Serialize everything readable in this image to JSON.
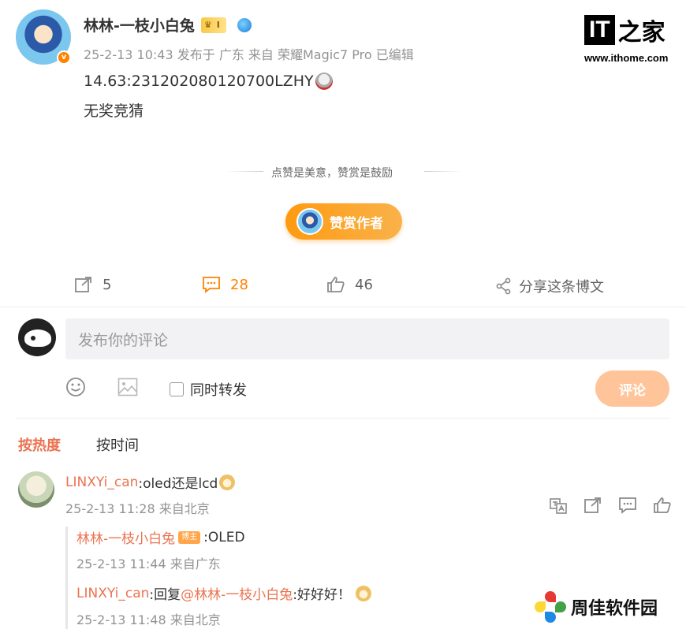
{
  "post": {
    "author": "林林-一枝小白兔",
    "member_badge_text": "I",
    "meta": "25-2-13 10:43 发布于 广东 来自 荣耀Magic7 Pro 已编辑",
    "line1": "14.63:231202080120700LZHY",
    "line2": "无奖竞猜"
  },
  "watermark": {
    "site": "www.ithome.com",
    "logo_text": "IT之家"
  },
  "reward": {
    "divider_text": "点赞是美意，赞赏是鼓励",
    "button_label": "赞赏作者"
  },
  "actions": {
    "repost_count": "5",
    "comment_count": "28",
    "like_count": "46",
    "share_label": "分享这条博文"
  },
  "composer": {
    "placeholder": "发布你的评论",
    "also_repost_label": "同时转发",
    "submit_label": "评论"
  },
  "sort_tabs": {
    "hot": "按热度",
    "time": "按时间"
  },
  "comments": [
    {
      "user": "LINXYi_can",
      "text": ":oled还是lcd",
      "meta": "25-2-13 11:28 来自北京",
      "replies": [
        {
          "user": "林林-一枝小白兔",
          "host_badge": "博主",
          "text": ":OLED",
          "meta": "25-2-13 11:44 来自广东"
        },
        {
          "user": "LINXYi_can",
          "reply_prefix": ":回复",
          "mention": "@林林-一枝小白兔",
          "text": ":好好好！",
          "meta": "25-2-13 11:48 来自北京"
        }
      ]
    }
  ],
  "corner_watermark": {
    "text": "周佳软件园"
  },
  "colors": {
    "accent_orange": "#ff8200",
    "link_orange": "#eb7350",
    "submit_button": "#ffc49a",
    "reward_button": "#f99b1c"
  }
}
